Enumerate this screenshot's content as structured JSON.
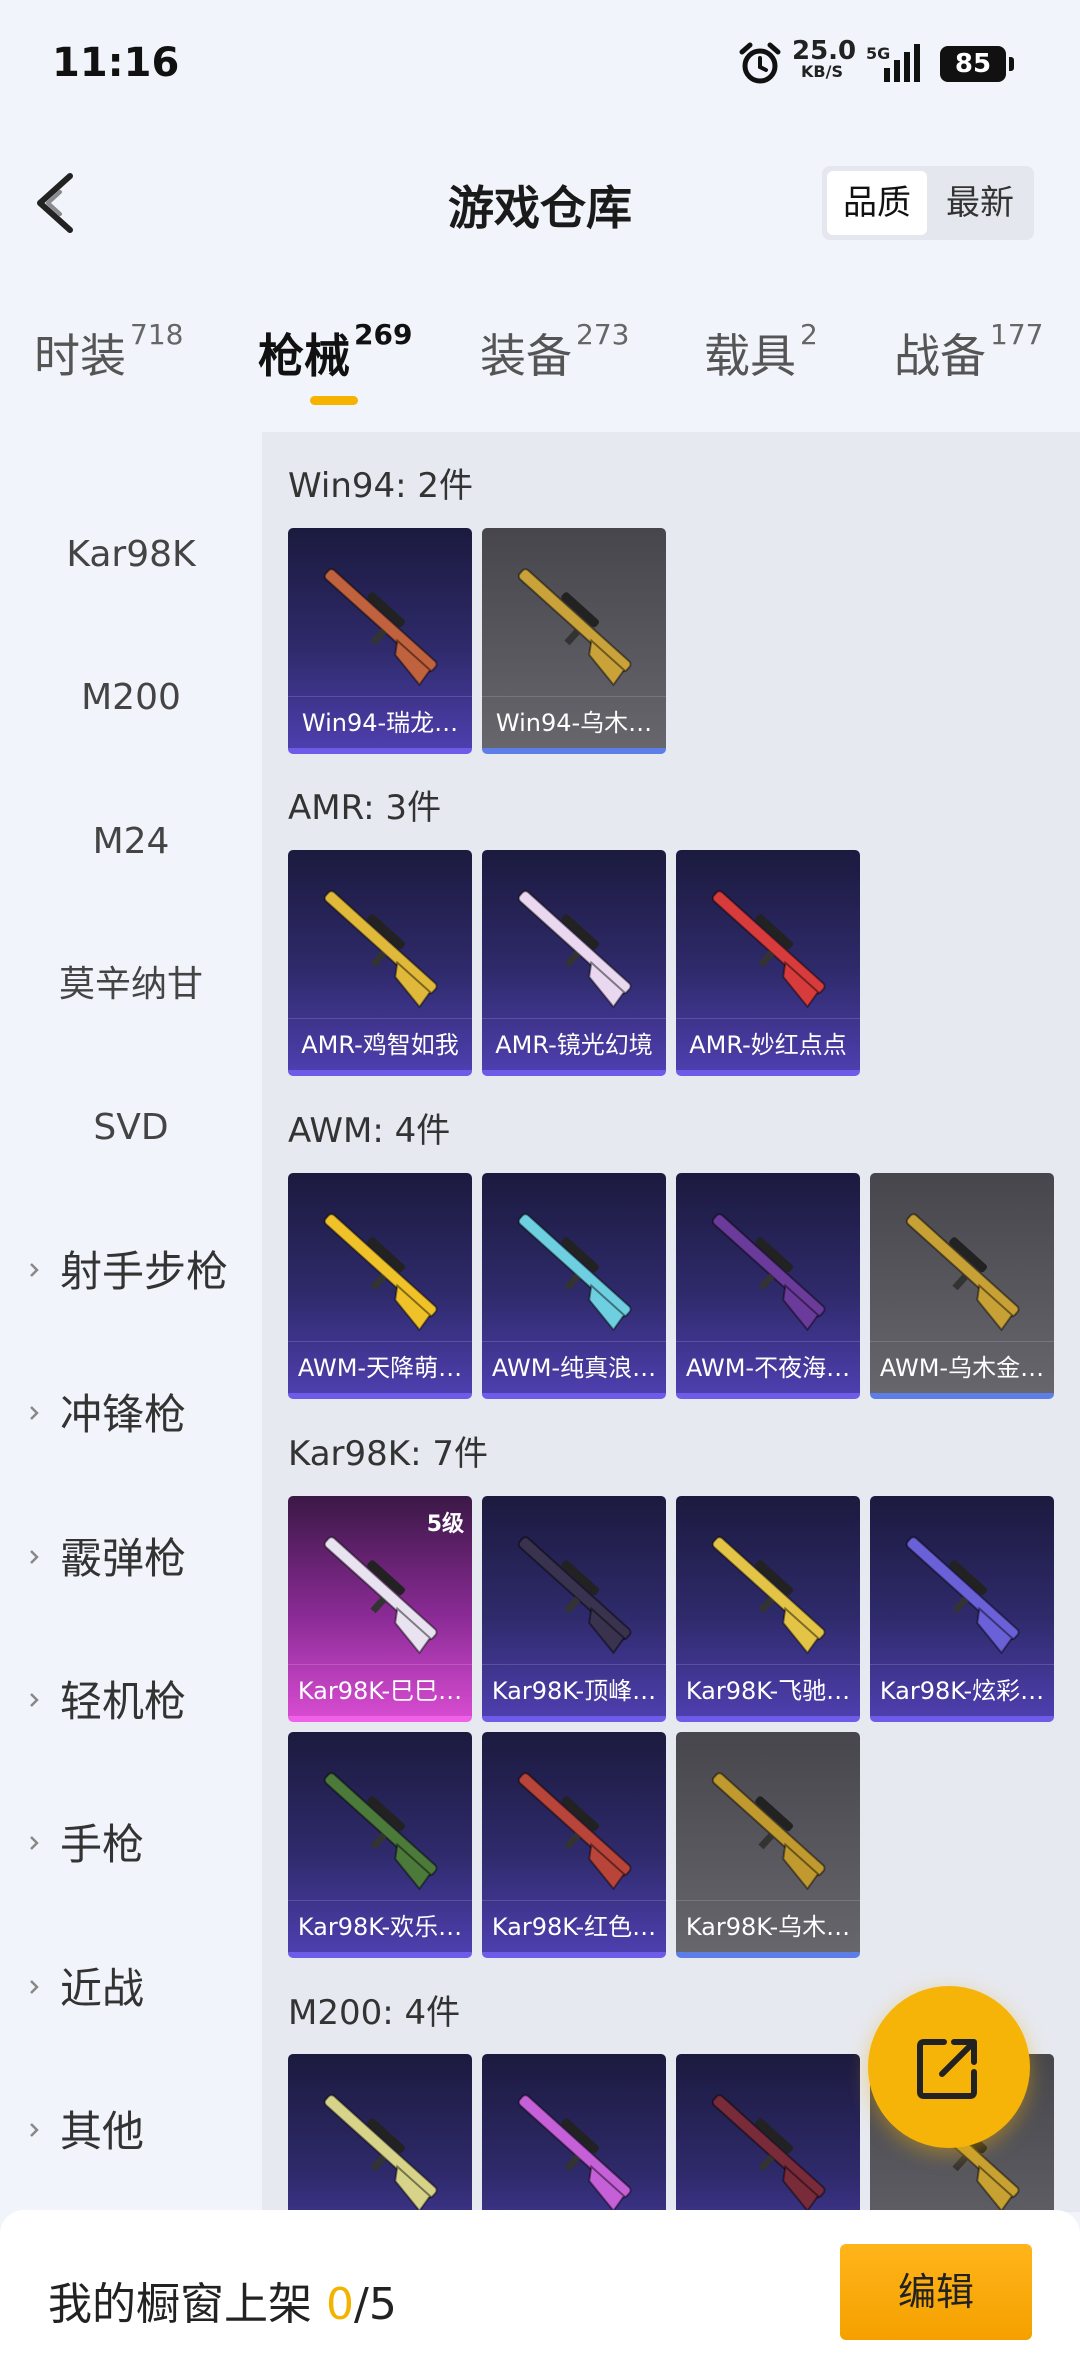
{
  "status_bar": {
    "time": "11:16",
    "speed_value": "25.0",
    "speed_unit": "KB/S",
    "network": "5G",
    "battery": "85"
  },
  "header": {
    "title": "游戏仓库",
    "sort_options": [
      "品质",
      "最新"
    ],
    "sort_selected": "品质"
  },
  "tabs": [
    {
      "label": "时装",
      "count": "718"
    },
    {
      "label": "枪械",
      "count": "269"
    },
    {
      "label": "装备",
      "count": "273"
    },
    {
      "label": "载具",
      "count": "2"
    },
    {
      "label": "战备",
      "count": "177"
    }
  ],
  "active_tab": "枪械",
  "sidebar": {
    "items": [
      "Kar98K",
      "M200",
      "M24",
      "莫辛纳甘",
      "SVD"
    ],
    "groups": [
      "射手步枪",
      "冲锋枪",
      "霰弹枪",
      "轻机枪",
      "手枪",
      "近战",
      "其他"
    ]
  },
  "groups": [
    {
      "title": "Win94: 2件",
      "items": [
        {
          "name": "Win94-瑞龙…",
          "quality": "purple",
          "gun_color": "#c0623e"
        },
        {
          "name": "Win94-乌木…",
          "quality": "grey",
          "gun_color": "#c9a23a"
        }
      ]
    },
    {
      "title": "AMR: 3件",
      "items": [
        {
          "name": "AMR-鸡智如我",
          "quality": "purple",
          "gun_color": "#e0b93a"
        },
        {
          "name": "AMR-镜光幻境",
          "quality": "purple",
          "gun_color": "#e9d8ef"
        },
        {
          "name": "AMR-妙红点点",
          "quality": "purple",
          "gun_color": "#d83b3b"
        }
      ]
    },
    {
      "title": "AWM: 4件",
      "items": [
        {
          "name": "AWM-天降萌…",
          "quality": "purple",
          "gun_color": "#f0c229"
        },
        {
          "name": "AWM-纯真浪…",
          "quality": "purple",
          "gun_color": "#6ecfe0"
        },
        {
          "name": "AWM-不夜海…",
          "quality": "purple",
          "gun_color": "#6b3b9b"
        },
        {
          "name": "AWM-乌木金…",
          "quality": "grey",
          "gun_color": "#c8a136"
        }
      ]
    },
    {
      "title": "Kar98K: 7件",
      "items": [
        {
          "name": "Kar98K-巳巳…",
          "quality": "pink",
          "level": "5级",
          "gun_color": "#e9e2f0"
        },
        {
          "name": "Kar98K-顶峰…",
          "quality": "purple",
          "gun_color": "#3a3350"
        },
        {
          "name": "Kar98K-飞驰…",
          "quality": "purple",
          "gun_color": "#e3c446"
        },
        {
          "name": "Kar98K-炫彩…",
          "quality": "purple",
          "gun_color": "#6a60d8"
        },
        {
          "name": "Kar98K-欢乐…",
          "quality": "purple",
          "gun_color": "#4c7a3a"
        },
        {
          "name": "Kar98K-红色…",
          "quality": "purple",
          "gun_color": "#b8443a"
        },
        {
          "name": "Kar98K-乌木…",
          "quality": "grey",
          "gun_color": "#c09a2e"
        }
      ]
    },
    {
      "title": "M200: 4件",
      "items": [
        {
          "name": "",
          "quality": "purple",
          "gun_color": "#d7d48a"
        },
        {
          "name": "",
          "quality": "purple",
          "gun_color": "#c560d8"
        },
        {
          "name": "",
          "quality": "purple",
          "gun_color": "#7a2b3a"
        },
        {
          "name": "",
          "quality": "grey",
          "gun_color": "#c7a131"
        }
      ]
    }
  ],
  "bottom": {
    "shelf_label": "我的橱窗上架",
    "shelf_current": "0",
    "shelf_total": "/5",
    "edit_label": "编辑"
  }
}
